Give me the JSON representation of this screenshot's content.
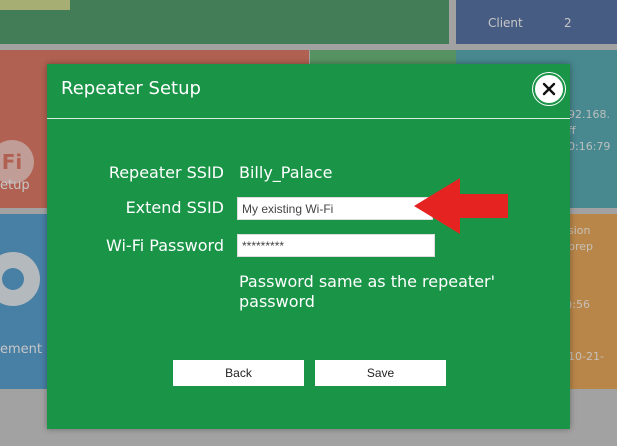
{
  "background": {
    "client_label": "Client",
    "client_count": "2",
    "ip_fragment": "92.168.",
    "status_fragment": "ff",
    "mac_fragment": "0:16:79",
    "setup_fragment": "etup",
    "fi_icon_text": "Fi",
    "version_fragment": "sion",
    "prep_fragment": "prep",
    "time_fragment": "):56",
    "date_fragment": "10-21-",
    "management_fragment": "ement"
  },
  "dialog": {
    "title": "Repeater Setup",
    "close_icon": "close-icon",
    "repeater_ssid_label": "Repeater SSID",
    "repeater_ssid_value": "Billy_Palace",
    "extend_ssid_label": "Extend SSID",
    "extend_ssid_value": "My existing Wi-Fi",
    "wifi_password_label": "Wi-Fi Password",
    "wifi_password_value": "*********",
    "password_note": "Password same as the repeater' password",
    "back_label": "Back",
    "save_label": "Save"
  },
  "colors": {
    "dialog_bg": "#1a9548",
    "annotation_arrow": "#e52320"
  }
}
